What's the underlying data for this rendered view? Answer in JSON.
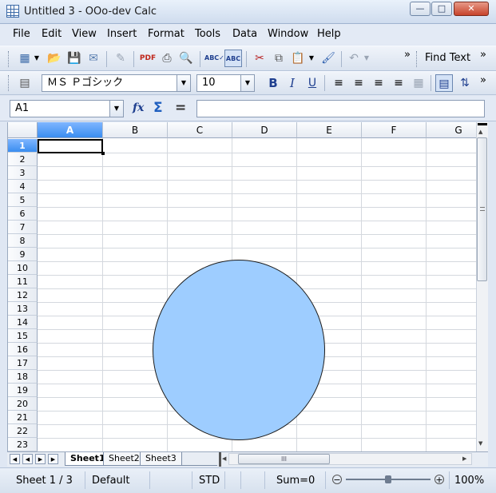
{
  "window": {
    "title": "Untitled 3 - OOo-dev Calc"
  },
  "menu": [
    {
      "label": "File",
      "ul": "F"
    },
    {
      "label": "Edit",
      "ul": "E"
    },
    {
      "label": "View",
      "ul": "V"
    },
    {
      "label": "Insert",
      "ul": "I"
    },
    {
      "label": "Format",
      "ul": "o"
    },
    {
      "label": "Tools",
      "ul": "T"
    },
    {
      "label": "Data",
      "ul": "D"
    },
    {
      "label": "Window",
      "ul": "W"
    },
    {
      "label": "Help",
      "ul": "H"
    }
  ],
  "toolbar": {
    "find_text": "Find Text",
    "overflow": "»"
  },
  "format_toolbar": {
    "font_name": "ＭＳ Ｐゴシック",
    "font_size": "10",
    "bold": "B",
    "italic": "I",
    "underline": "U"
  },
  "formula_bar": {
    "name_box": "A1",
    "function_wizard": "fx",
    "sum": "Σ",
    "equals": "=",
    "formula_value": ""
  },
  "grid": {
    "columns": [
      "A",
      "B",
      "C",
      "D",
      "E",
      "F",
      "G"
    ],
    "rows": [
      "1",
      "2",
      "3",
      "4",
      "5",
      "6",
      "7",
      "8",
      "9",
      "10",
      "11",
      "12",
      "13",
      "14",
      "15",
      "16",
      "17",
      "18",
      "19",
      "20",
      "21",
      "22",
      "23"
    ],
    "selected_cell": "A1"
  },
  "sheets": [
    "Sheet1",
    "Sheet2",
    "Sheet3"
  ],
  "active_sheet": "Sheet1",
  "hscroll_thumb_label": "III",
  "statusbar": {
    "sheet": "Sheet 1 / 3",
    "style": "Default",
    "mode": "STD",
    "sum": "Sum=0",
    "zoom": "100%",
    "zoom_minus": "−",
    "zoom_plus": "+"
  },
  "colors": {
    "shape_fill": "#9ecdff",
    "selection_header": "#3a8df0"
  }
}
